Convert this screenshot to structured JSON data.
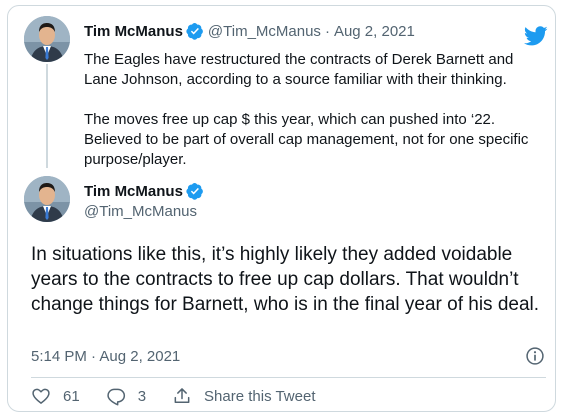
{
  "brand_color": "#1d9bf0",
  "quoted_tweet": {
    "author_name": "Tim McManus",
    "handle": "@Tim_McManus",
    "separator": "·",
    "date": "Aug 2, 2021",
    "verified_icon": "verified-badge-icon",
    "paragraphs": [
      "The Eagles have restructured the contracts of Derek Barnett and Lane Johnson, according to a source familiar with their thinking.",
      "The moves free up cap $ this year, which can pushed into ‘22. Believed to be part of overall cap management, not for one specific purpose/player."
    ]
  },
  "tweet": {
    "author_name": "Tim McManus",
    "handle": "@Tim_McManus",
    "verified_icon": "verified-badge-icon",
    "text": "In situations like this, it’s highly likely they added voidable years to the contracts to free up cap dollars. That wouldn’t change things for Barnett, who is in the final year of his deal.",
    "timestamp": "5:14 PM · Aug 2, 2021"
  },
  "actions": {
    "likes": "61",
    "replies": "3",
    "share_label": "Share this Tweet"
  },
  "icons": {
    "logo": "twitter-bird-icon",
    "info": "info-icon",
    "like": "heart-icon",
    "reply": "reply-icon",
    "share": "share-icon"
  }
}
